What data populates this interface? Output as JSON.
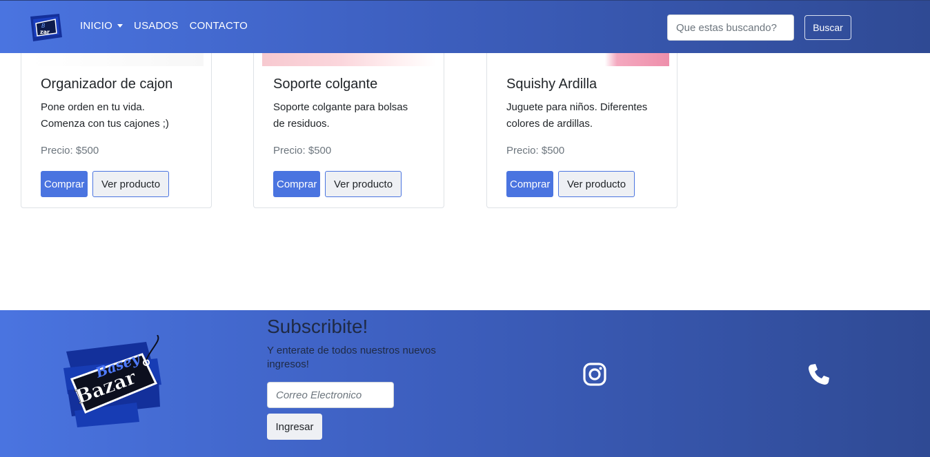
{
  "nav": {
    "logo_alt": "Basey Bazar",
    "links": [
      "INICIO",
      "USADOS",
      "CONTACTO"
    ],
    "search_placeholder": "Que estas buscando?",
    "search_button": "Buscar"
  },
  "products": [
    {
      "title": "Organizador de cajon",
      "description": "Pone orden en tu vida. Comenza con tus cajones ;)",
      "price": "Precio: $500",
      "buy_label": "Comprar",
      "view_label": "Ver producto"
    },
    {
      "title": "Soporte colgante",
      "description": "Soporte colgante para bolsas de residuos.",
      "price": "Precio: $500",
      "buy_label": "Comprar",
      "view_label": "Ver producto"
    },
    {
      "title": "Squishy Ardilla",
      "description": "Juguete para niños. Diferentes colores de ardillas.",
      "price": "Precio: $500",
      "buy_label": "Comprar",
      "view_label": "Ver producto"
    }
  ],
  "footer": {
    "logo_text_top": "Basey",
    "logo_text_bottom": "Bazar",
    "subscribe_title": "Subscribite!",
    "subscribe_text": "Y enterate de todos nuestros nuevos ingresos!",
    "email_placeholder": "Correo Electronico",
    "submit_label": "Ingresar",
    "icons": [
      "instagram-icon",
      "phone-icon"
    ]
  },
  "colors": {
    "brand_primary": "#4a74e0",
    "brand_dark": "#2f4a94",
    "white": "#ffffff"
  }
}
